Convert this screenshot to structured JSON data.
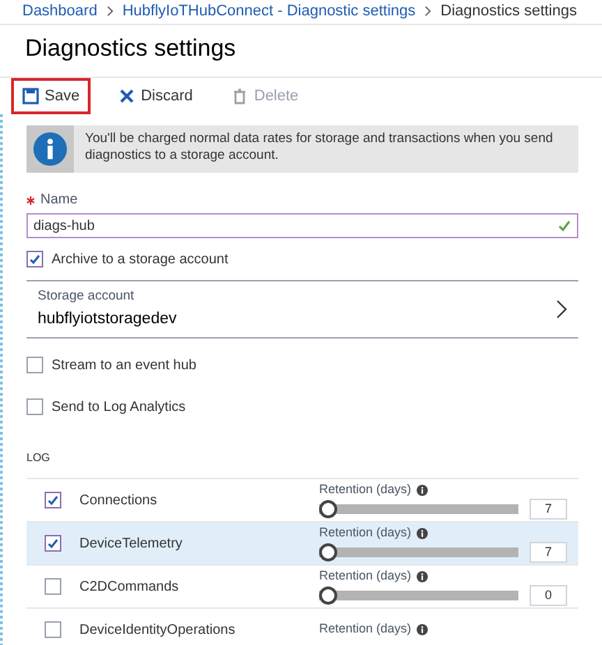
{
  "breadcrumb": [
    {
      "label": "Dashboard",
      "link": true
    },
    {
      "label": "HubflyIoTHubConnect - Diagnostic settings",
      "link": true
    },
    {
      "label": "Diagnostics settings",
      "link": false
    }
  ],
  "title": "Diagnostics settings",
  "toolbar": [
    {
      "kind": "save",
      "label": "Save",
      "disabled": false,
      "highlighted": true
    },
    {
      "kind": "discard",
      "label": "Discard",
      "disabled": false,
      "highlighted": false
    },
    {
      "kind": "delete",
      "label": "Delete",
      "disabled": true,
      "highlighted": false
    }
  ],
  "info": "You'll be charged normal data rates for storage and transactions when you send diagnostics to a storage account.",
  "name_field": {
    "label": "Name",
    "required": true,
    "value": "diags-hub",
    "valid": true
  },
  "archive": {
    "label": "Archive to a storage account",
    "checked": true
  },
  "storage_account": {
    "label": "Storage account",
    "value": "hubflyiotstoragedev"
  },
  "options": [
    {
      "label": "Stream to an event hub",
      "checked": false
    },
    {
      "label": "Send to Log Analytics",
      "checked": false
    }
  ],
  "log": {
    "heading": "LOG",
    "rows": [
      {
        "name": "Connections",
        "checked": true,
        "selected": false,
        "retention_label": "Retention (days)",
        "level": 0,
        "value": "7"
      },
      {
        "name": "DeviceTelemetry",
        "checked": true,
        "selected": true,
        "retention_label": "Retention (days)",
        "level": 0,
        "value": "7"
      },
      {
        "name": "C2DCommands",
        "checked": false,
        "selected": false,
        "retention_label": "Retention (days)",
        "level": 0,
        "value": "0"
      },
      {
        "name": "DeviceIdentityOperations",
        "checked": false,
        "selected": false,
        "retention_label": "Retention (days)"
      }
    ]
  }
}
